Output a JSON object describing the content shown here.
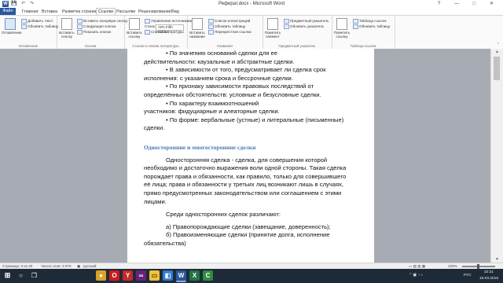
{
  "window": {
    "title": "Реферат.docx - Microsoft Word",
    "qat_icons": [
      "save-icon",
      "undo-icon",
      "redo-icon"
    ],
    "controls": [
      "?",
      "—",
      "□",
      "✕"
    ]
  },
  "tabs": [
    "Файл",
    "Главная",
    "Вставка",
    "Разметка страницы",
    "Ссылки",
    "Рассылки",
    "Рецензирование",
    "Вид"
  ],
  "active_tab": "Ссылки",
  "ribbon": {
    "groups": {
      "contents": "Оглавление",
      "footnotes": "Сноски",
      "citations": "Ссылки и списки литературы",
      "captions": "Названия",
      "index": "Предметный указатель",
      "authorities": "Таблица ссылок"
    },
    "contents": {
      "toc": "Оглавление",
      "add_text": "Добавить текст",
      "update_table": "Обновить таблицу"
    },
    "footnotes": {
      "insert_footnote": "Вставить сноску",
      "insert_endnote": "Вставить концевую сноску",
      "next_footnote": "Следующая сноска",
      "show_notes": "Показать сноски"
    },
    "citations": {
      "insert_citation": "Вставить ссылку",
      "manage_sources": "Управление источниками",
      "style_label": "Стиль:",
      "style_value": "APA Fifth Edition",
      "bibliography": "Список литературы"
    },
    "captions": {
      "insert_caption": "Вставить название",
      "table_of_figures": "Список иллюстраций",
      "update_table": "Обновить таблицу",
      "cross_reference": "Перекрестная ссылка"
    },
    "index": {
      "mark_entry": "Пометить элемент",
      "insert_index": "Предметный указатель",
      "update_index": "Обновить указатель"
    },
    "authorities": {
      "mark_citation": "Пометить ссылку",
      "insert_table": "Таблица ссылок",
      "update_table": "Обновить таблицу"
    }
  },
  "document": {
    "lines_top": [
      "• По значению оснований сделки для ее",
      "действительности: каузальные и абстрактные сделки."
    ],
    "bullet2_a": "• В зависимости от того, предусматривает ли сделка срок",
    "bullet2_b": "исполнения: с указанием срока и бессрочные сделки.",
    "bullet3_a": "• По признаку зависимости правовых последствий от",
    "bullet3_b": "определённых обстоятельств: условные и безусловные сделки.",
    "bullet4_a": "• По характеру взаимоотношений",
    "bullet4_b": "участников: фидуциарные и алеаторные сделки.",
    "bullet5_a": "• По форме: вербальные (устные) и литеральные (письменные)",
    "bullet5_b": "сделки.",
    "heading": "Односторонние и многосторонние сделки",
    "para1": [
      "Односторонняя сделка - сделка, для совершения которой",
      "необходимо и достаточно выражения воли одной стороны. Такая сделка",
      "порождает права и обязанности, как правило, только для совершившего",
      "её лица; права и обязанности у третьих лиц возникают лишь в случаях,",
      "прямо предусмотренных законодательством или соглашением с этими",
      "лицами."
    ],
    "para2": "Среди односторонних сделок различают:",
    "item_a": "а) Правопорождающие сделки (завещание, доверенность);",
    "item_b1": "б) Правоизменяющие сделки (принятие долга, исполнение",
    "item_b2": "обязательства)"
  },
  "status": {
    "page": "Страница: 3 из 20",
    "words": "Число слов: 3 870",
    "lang": "русский",
    "zoom": "100%"
  },
  "taskbar": {
    "apps": [
      "start-icon",
      "search-icon",
      "task-view-icon",
      "chrome-icon",
      "opera-icon",
      "yandex-icon",
      "visual-studio-icon",
      "file-explorer-icon",
      "store-icon",
      "word-icon",
      "excel-icon",
      "camtasia-icon"
    ],
    "lang": "РУС",
    "time": "22:21",
    "date": "16.03.2016"
  },
  "colors": {
    "word_blue": "#2b579a",
    "heading_blue": "#4f79b8",
    "taskbar": "#1e2a38"
  }
}
